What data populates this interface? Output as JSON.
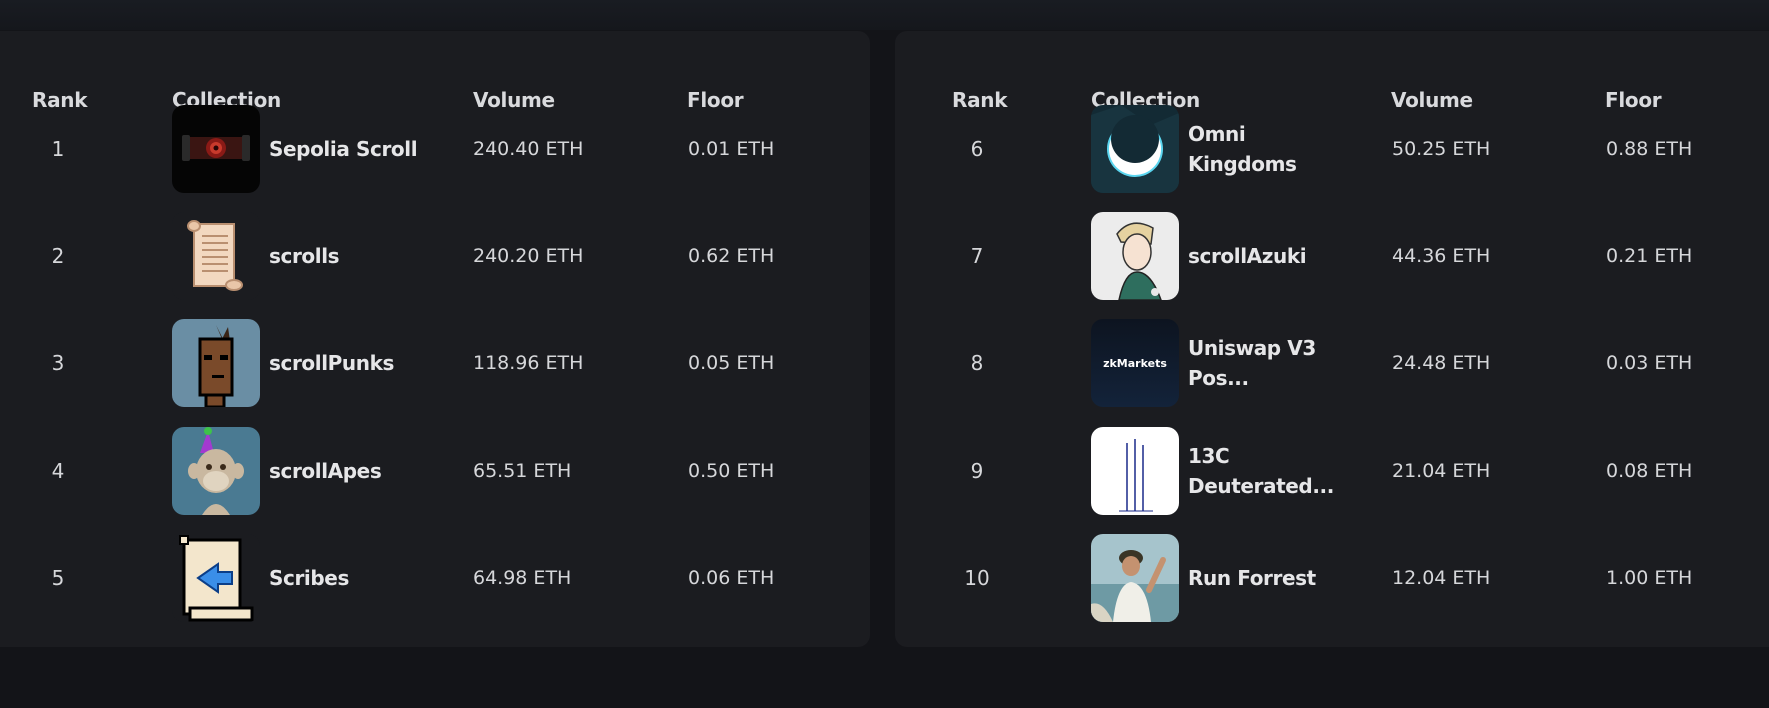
{
  "headers": {
    "rank": "Rank",
    "collection": "Collection",
    "volume": "Volume",
    "floor": "Floor"
  },
  "left_rows": [
    {
      "rank": "1",
      "name": "Sepolia Scroll",
      "volume": "240.40 ETH",
      "floor": "0.01 ETH",
      "icon": "sepolia-scroll-thumbnail"
    },
    {
      "rank": "2",
      "name": "scrolls",
      "volume": "240.20 ETH",
      "floor": "0.62 ETH",
      "icon": "scrolls-thumbnail"
    },
    {
      "rank": "3",
      "name": "scrollPunks",
      "volume": "118.96 ETH",
      "floor": "0.05 ETH",
      "icon": "scrollpunks-thumbnail"
    },
    {
      "rank": "4",
      "name": "scrollApes",
      "volume": "65.51 ETH",
      "floor": "0.50 ETH",
      "icon": "scrollapes-thumbnail"
    },
    {
      "rank": "5",
      "name": "Scribes",
      "volume": "64.98 ETH",
      "floor": "0.06 ETH",
      "icon": "scribes-thumbnail"
    }
  ],
  "right_rows": [
    {
      "rank": "6",
      "name": "Omni Kingdoms",
      "volume": "50.25 ETH",
      "floor": "0.88 ETH",
      "icon": "omni-kingdoms-thumbnail"
    },
    {
      "rank": "7",
      "name": "scrollAzuki",
      "volume": "44.36 ETH",
      "floor": "0.21 ETH",
      "icon": "scrollazuki-thumbnail"
    },
    {
      "rank": "8",
      "name": "Uniswap V3 Pos...",
      "volume": "24.48 ETH",
      "floor": "0.03 ETH",
      "icon": "zkmarkets-thumbnail",
      "thumb_text": "zkMarkets"
    },
    {
      "rank": "9",
      "name": "13C Deuterated...",
      "volume": "21.04 ETH",
      "floor": "0.08 ETH",
      "icon": "13c-spectrum-thumbnail"
    },
    {
      "rank": "10",
      "name": "Run Forrest",
      "volume": "12.04 ETH",
      "floor": "1.00 ETH",
      "icon": "run-forrest-thumbnail"
    }
  ],
  "colors": {
    "background": "#131418",
    "panel": "#1b1c20",
    "text": "#e6e6e8"
  }
}
